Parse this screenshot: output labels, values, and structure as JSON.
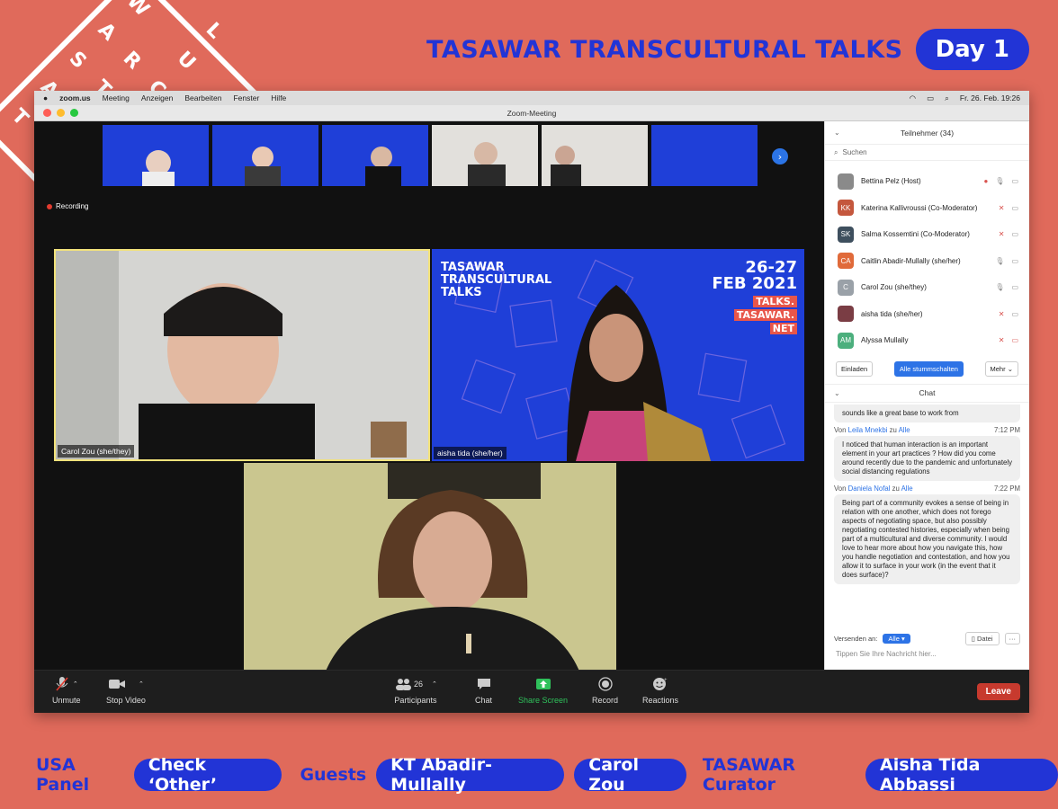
{
  "header": {
    "title": "TASAWAR TRANSCULTURAL TALKS",
    "day": "Day 1"
  },
  "logo_letters": [
    "T",
    "A",
    "S",
    "A",
    "W",
    "A",
    "R",
    "T",
    "R",
    "A",
    "N",
    "S",
    "C",
    "U",
    "L",
    "T",
    "U",
    "R",
    "A",
    "L",
    "T",
    "A",
    "L",
    "K",
    "S"
  ],
  "menubar": {
    "app": "zoom.us",
    "items": [
      "Meeting",
      "Anzeigen",
      "Bearbeiten",
      "Fenster",
      "Hilfe"
    ],
    "clock": "Fr. 26. Feb.  19:26"
  },
  "window_title": "Zoom-Meeting",
  "recording_label": "Recording",
  "thumb_text": {
    "talks": "TASAWAR\nTRANSCULTURAL\nTALKS",
    "date": "26-27\nFEB 2021"
  },
  "videos": {
    "carol": "Carol Zou (she/they)",
    "aisha": "aisha tida (she/her)",
    "aisha_title_1": "TASAWAR",
    "aisha_title_2": "TRANSCULTURAL",
    "aisha_title_3": "TALKS",
    "aisha_date_1": "26-27",
    "aisha_date_2": "FEB 2021",
    "aisha_tag_1": "TALKS.",
    "aisha_tag_2": "TASAWAR.",
    "aisha_tag_3": "NET"
  },
  "toolbar": {
    "unmute": "Unmute",
    "stop_video": "Stop Video",
    "participants": "Participants",
    "participants_count": "26",
    "chat": "Chat",
    "share": "Share Screen",
    "record": "Record",
    "reactions": "Reactions",
    "leave": "Leave"
  },
  "panel": {
    "participants_title": "Teilnehmer (34)",
    "search_placeholder": "Suchen",
    "participants": [
      {
        "initials": "",
        "name": "Bettina Pelz (Host)",
        "color": "#8a8a8a"
      },
      {
        "initials": "KK",
        "name": "Katerina Kallivroussi (Co-Moderator)",
        "color": "#c4573d"
      },
      {
        "initials": "SK",
        "name": "Salma Kossemtini (Co-Moderator)",
        "color": "#3e4f5e"
      },
      {
        "initials": "CA",
        "name": "Caitlin Abadir-Mullally (she/her)",
        "color": "#e06a3a"
      },
      {
        "initials": "C",
        "name": "Carol Zou (she/they)",
        "color": "#9aa1a8"
      },
      {
        "initials": "",
        "name": "aisha tida (she/her)",
        "color": "#7a3d44"
      },
      {
        "initials": "AM",
        "name": "Alyssa Mullally",
        "color": "#4caf7d"
      }
    ],
    "invite": "Einladen",
    "mute_all": "Alle stummschalten",
    "more": "Mehr",
    "chat_title": "Chat",
    "chat_prev": "sounds like a great base to work from",
    "messages": [
      {
        "from": "Leila Mnekbi",
        "to": "Alle",
        "time": "7:12 PM",
        "text": "I noticed that human interaction is an important element in your art practices ? How did you come around recently due to the pandemic and unfortunately social distancing regulations"
      },
      {
        "from": "Daniela Nofal",
        "to": "Alle",
        "time": "7:22 PM",
        "text": "Being part of a community evokes a sense of being in relation with one another, which does not forego aspects  of negotiating space, but also possibly negotiating contested histories, especially when being part of a multicultural and diverse community. I would love to hear more about how you navigate this, how you handle negotiation and contestation, and how you allow it to surface in your work (in the event that it does surface)?"
      }
    ],
    "von": "Von",
    "zu": "zu",
    "send_to": "Versenden an:",
    "send_target": "Alle",
    "file": "Datei",
    "input_placeholder": "Tippen Sie Ihre Nachricht hier..."
  },
  "footer": {
    "usa_panel": "USA Panel",
    "check_other": "Check ‘Other’",
    "guests": "Guests",
    "guest1": "KT Abadir-Mullally",
    "guest2": "Carol Zou",
    "curator_label": "TASAWAR Curator",
    "curator": "Aisha Tida Abbassi"
  },
  "colors": {
    "background": "#e06a5b",
    "brand_blue": "#2234d6",
    "zoom_blue": "#2d73e6",
    "leave_red": "#c73a2e",
    "share_green": "#2fc15b"
  }
}
